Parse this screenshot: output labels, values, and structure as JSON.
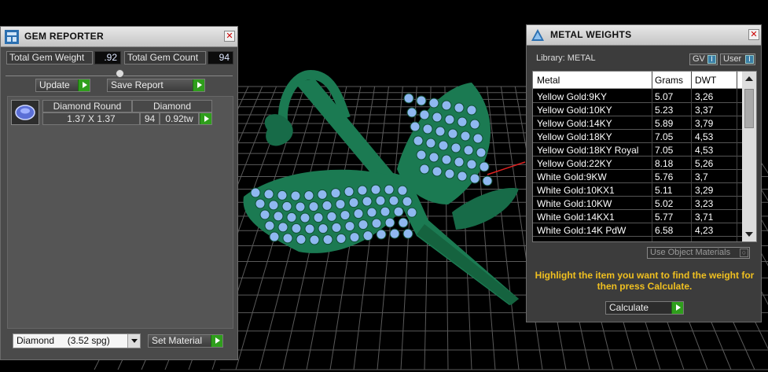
{
  "gem_reporter": {
    "title": "GEM REPORTER",
    "close_glyph": "✕",
    "total_weight_label": "Total Gem Weight",
    "total_weight_value": ".92",
    "total_count_label": "Total Gem Count",
    "total_count_value": "94",
    "update_label": "Update",
    "save_report_label": "Save Report",
    "gem_row": {
      "shape": "Diamond Round",
      "size": "1.37 X 1.37",
      "material": "Diamond",
      "count": "94",
      "weight": "0.92tw"
    },
    "material_select_value": "Diamond     (3.52 spg)",
    "set_material_label": "Set Material"
  },
  "metal_weights": {
    "title": "METAL WEIGHTS",
    "close_glyph": "✕",
    "library_label": "Library: METAL",
    "gv_label": "GV",
    "user_label": "User",
    "columns": [
      "Metal",
      "Grams",
      "DWT"
    ],
    "rows": [
      {
        "metal": "Yellow Gold:9KY",
        "grams": "5.07",
        "dwt": "3,26"
      },
      {
        "metal": "Yellow Gold:10KY",
        "grams": "5.23",
        "dwt": "3,37"
      },
      {
        "metal": "Yellow Gold:14KY",
        "grams": "5.89",
        "dwt": "3,79"
      },
      {
        "metal": "Yellow Gold:18KY",
        "grams": "7.05",
        "dwt": "4,53"
      },
      {
        "metal": "Yellow Gold:18KY Royal",
        "grams": "7.05",
        "dwt": "4,53"
      },
      {
        "metal": "Yellow Gold:22KY",
        "grams": "8.18",
        "dwt": "5,26"
      },
      {
        "metal": "White Gold:9KW",
        "grams": "5.76",
        "dwt": "3,7"
      },
      {
        "metal": "White Gold:10KX1",
        "grams": "5.11",
        "dwt": "3,29"
      },
      {
        "metal": "White Gold:10KW",
        "grams": "5.02",
        "dwt": "3,23"
      },
      {
        "metal": "White Gold:14KX1",
        "grams": "5.77",
        "dwt": "3,71"
      },
      {
        "metal": "White Gold:14K PdW",
        "grams": "6.58",
        "dwt": "4,23"
      }
    ],
    "use_object_materials_label": "Use Object Materials",
    "hint": "Highlight the item you want to find the weight for then press Calculate.",
    "calculate_label": "Calculate"
  },
  "colors": {
    "model": "#1b7a52",
    "model_dark": "#0f4f33",
    "gem": "#8fb8f0",
    "grid": "#5a5a5a",
    "go_button": "#2f9e1c",
    "hint": "#f0c020"
  }
}
